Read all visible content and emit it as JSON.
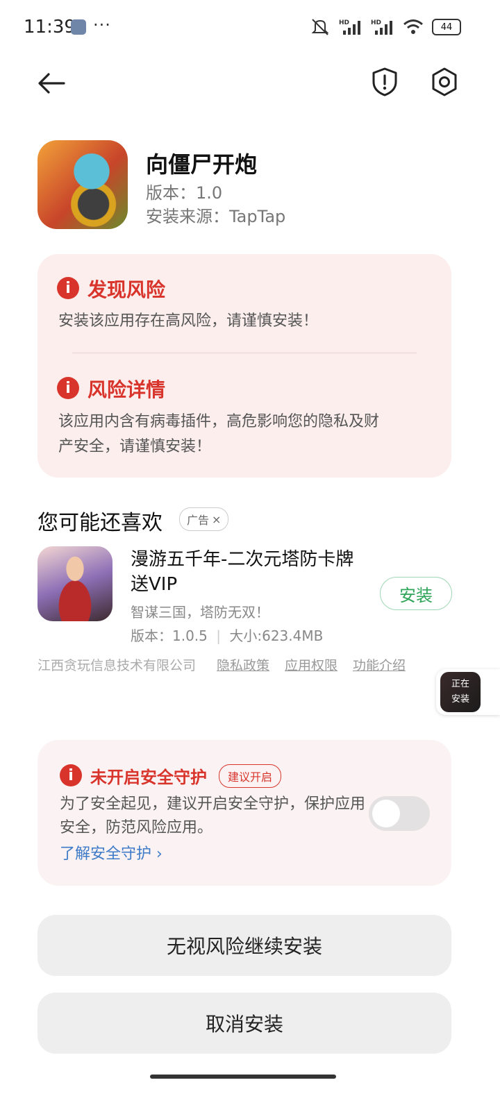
{
  "status_bar": {
    "time": "11:39",
    "more": "···",
    "battery": "44",
    "icons": [
      "wrench-icon",
      "mute-icon",
      "signal-hd-icon",
      "signal-hd-icon",
      "wifi-icon",
      "battery-icon"
    ]
  },
  "top_bar": {
    "back_icon": "arrow-left-icon",
    "shield_icon": "shield-exclamation-icon",
    "settings_icon": "gear-icon"
  },
  "app": {
    "name": "向僵尸开炮",
    "version": "版本：1.0",
    "source": "安装来源：TapTap"
  },
  "risk": {
    "found_title": "发现风险",
    "found_text": "安装该应用存在高风险，请谨慎安装！",
    "detail_title": "风险详情",
    "detail_text_1": "该应用内含有病毒插件，高危影响您的隐私及财",
    "detail_text_2": "产安全，请谨慎安装！",
    "warning_icon_glyph": "i",
    "accent_color": "#d9342b"
  },
  "recommend": {
    "title": "您可能还喜欢",
    "ad_label": "广告",
    "ad_close": "×",
    "item": {
      "name_line1": "漫游五千年-二次元塔防卡牌",
      "name_line2": "送VIP",
      "desc": "智谋三国，塔防无双！",
      "version": "版本：1.0.5",
      "separator": "|",
      "size": "大小:623.4MB",
      "install_label": "安装"
    }
  },
  "footer_links": {
    "company": "江西贪玩信息技术有限公司",
    "privacy": "隐私政策",
    "permissions": "应用权限",
    "features": "功能介绍"
  },
  "floating": {
    "line1": "正在",
    "line2": "安装"
  },
  "protection": {
    "title": "未开启安全守护",
    "badge": "建议开启",
    "desc": "为了安全起见，建议开启安全守护，保护应用安全，防范风险应用。",
    "link": "了解安全守护 ›",
    "enabled": false
  },
  "buttons": {
    "continue": "无视风险继续安装",
    "cancel": "取消安装"
  }
}
